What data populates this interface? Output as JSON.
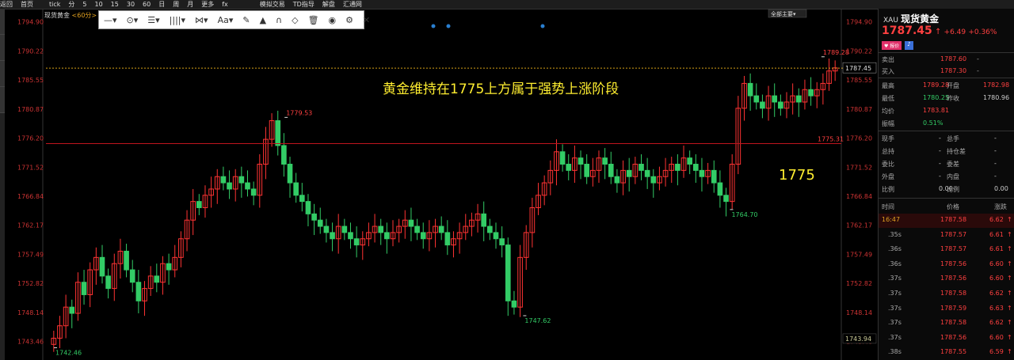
{
  "topbar": {
    "items": [
      "返回",
      "首页",
      "",
      "tick",
      "分",
      "5",
      "10",
      "15",
      "30",
      "60",
      "日",
      "周",
      "月",
      "更多",
      "fx",
      "",
      "",
      "",
      "模拟交易",
      "TD指导",
      "解盘",
      "汇通网"
    ]
  },
  "chart_header": {
    "title": "现货黄金",
    "timeframe": "<60分>"
  },
  "toolbar": {
    "items": [
      "—▾",
      "⊙▾",
      "☰▾",
      "||||▾",
      "⋈▾",
      "Aa▾",
      "✎",
      "▲",
      "∩",
      "◇",
      "🗑",
      "◉",
      "⚙",
      "✕"
    ]
  },
  "colors": {
    "up": "#ff3333",
    "down": "#33cc66",
    "hline": "#c0141e",
    "price_line": "#d4a017",
    "annotation": "#ffee30"
  },
  "main_annotation": "黄金维持在1775上方属于强势上涨阶段",
  "level_annotation": "1775",
  "top_right_label": "全部主要▾",
  "chart_data": {
    "type": "candlestick",
    "y_ticks": [
      "1794.90",
      "1790.22",
      "1785.55",
      "1780.87",
      "1776.20",
      "1771.52",
      "1766.84",
      "1762.17",
      "1757.49",
      "1752.82",
      "1748.14",
      "1743.46"
    ],
    "ylim": [
      1741.0,
      1796.0
    ],
    "current_price": "1787.45",
    "bottom_price": "1743.94",
    "hline_label": "1775.31",
    "hline_value": 1775.31,
    "markers": [
      {
        "label": "1742.46",
        "value": 1742.46
      },
      {
        "label": "1779.53",
        "value": 1779.53
      },
      {
        "label": "1747.62",
        "value": 1747.62
      },
      {
        "label": "1764.70",
        "value": 1764.7
      },
      {
        "label": "1789.28",
        "value": 1789.28
      }
    ],
    "closes": [
      1744.0,
      1746.0,
      1749.0,
      1748.0,
      1753.0,
      1751.0,
      1755.0,
      1757.0,
      1754.0,
      1752.0,
      1756.0,
      1758.0,
      1755.0,
      1753.0,
      1750.0,
      1752.0,
      1754.0,
      1753.0,
      1756.0,
      1755.0,
      1757.0,
      1760.0,
      1763.0,
      1766.0,
      1765.0,
      1767.0,
      1768.0,
      1770.0,
      1769.0,
      1768.0,
      1770.0,
      1769.0,
      1768.0,
      1767.0,
      1772.0,
      1776.0,
      1779.0,
      1775.0,
      1772.0,
      1769.0,
      1767.0,
      1766.0,
      1764.0,
      1763.0,
      1762.0,
      1761.0,
      1760.0,
      1762.0,
      1761.0,
      1760.0,
      1759.0,
      1760.0,
      1761.0,
      1762.0,
      1761.0,
      1760.0,
      1761.0,
      1762.0,
      1763.0,
      1762.0,
      1761.0,
      1760.0,
      1761.0,
      1762.0,
      1761.0,
      1759.0,
      1760.0,
      1761.0,
      1762.0,
      1763.0,
      1764.0,
      1762.0,
      1761.0,
      1760.0,
      1759.0,
      1750.0,
      1749.0,
      1757.0,
      1761.0,
      1765.0,
      1767.0,
      1769.0,
      1771.0,
      1774.0,
      1772.0,
      1771.0,
      1773.0,
      1772.0,
      1770.0,
      1771.0,
      1773.0,
      1772.0,
      1770.0,
      1769.0,
      1771.0,
      1770.0,
      1772.0,
      1771.0,
      1770.0,
      1769.0,
      1770.0,
      1771.0,
      1772.0,
      1771.0,
      1773.0,
      1772.0,
      1771.0,
      1770.0,
      1771.0,
      1769.0,
      1767.0,
      1766.0,
      1772.0,
      1781.0,
      1785.0,
      1783.0,
      1782.0,
      1781.0,
      1783.0,
      1782.0,
      1781.0,
      1782.0,
      1783.0,
      1782.0,
      1784.0,
      1783.0,
      1784.0,
      1785.0,
      1787.0,
      1787.5
    ]
  },
  "right_panel": {
    "symbol": "XAU",
    "name": "现货黄金",
    "price": "1787.45",
    "arrow": "↑",
    "change": "+6.49",
    "change_pct": "+0.36%",
    "tag": "♥ 报价",
    "ask_label": "卖出",
    "ask": "1787.60",
    "ask_vol": "-",
    "bid_label": "买入",
    "bid": "1787.30",
    "bid_vol": "-",
    "stats": [
      {
        "l1": "最高",
        "v1": "1789.28",
        "l2": "开盘",
        "v2": "1782.98",
        "c1": "#ff4040",
        "c2": "#ff4040"
      },
      {
        "l1": "最低",
        "v1": "1780.25",
        "l2": "昨收",
        "v2": "1780.96",
        "c1": "#33cc66",
        "c2": "#ccc"
      },
      {
        "l1": "均价",
        "v1": "1783.81",
        "l2": "",
        "v2": "",
        "c1": "#ff4040",
        "c2": "#ccc"
      },
      {
        "l1": "振幅",
        "v1": "0.51%",
        "l2": "",
        "v2": "",
        "c1": "#33cc66",
        "c2": "#ccc"
      }
    ],
    "vol_rows": [
      {
        "l1": "现手",
        "v1": "-",
        "l2": "总手",
        "v2": "-"
      },
      {
        "l1": "总持",
        "v1": "-",
        "l2": "持仓差",
        "v2": "-"
      },
      {
        "l1": "委比",
        "v1": "-",
        "l2": "委差",
        "v2": "-"
      },
      {
        "l1": "外盘",
        "v1": "-",
        "l2": "内盘",
        "v2": "-"
      },
      {
        "l1": "比例",
        "v1": "0.00",
        "l2": "比例",
        "v2": "0.00"
      }
    ],
    "tick_headers": [
      "时间",
      "价格",
      "涨跌"
    ],
    "ticks": [
      {
        "t": "16:47",
        "p": "1787.58",
        "c": "6.62"
      },
      {
        "t": ".35s",
        "p": "1787.57",
        "c": "6.61"
      },
      {
        "t": ".36s",
        "p": "1787.57",
        "c": "6.61"
      },
      {
        "t": ".36s",
        "p": "1787.56",
        "c": "6.60"
      },
      {
        "t": ".37s",
        "p": "1787.56",
        "c": "6.60"
      },
      {
        "t": ".37s",
        "p": "1787.58",
        "c": "6.62"
      },
      {
        "t": ".37s",
        "p": "1787.59",
        "c": "6.63"
      },
      {
        "t": ".37s",
        "p": "1787.58",
        "c": "6.62"
      },
      {
        "t": ".37s",
        "p": "1787.56",
        "c": "6.60"
      },
      {
        "t": ".38s",
        "p": "1787.55",
        "c": "6.59"
      }
    ]
  }
}
